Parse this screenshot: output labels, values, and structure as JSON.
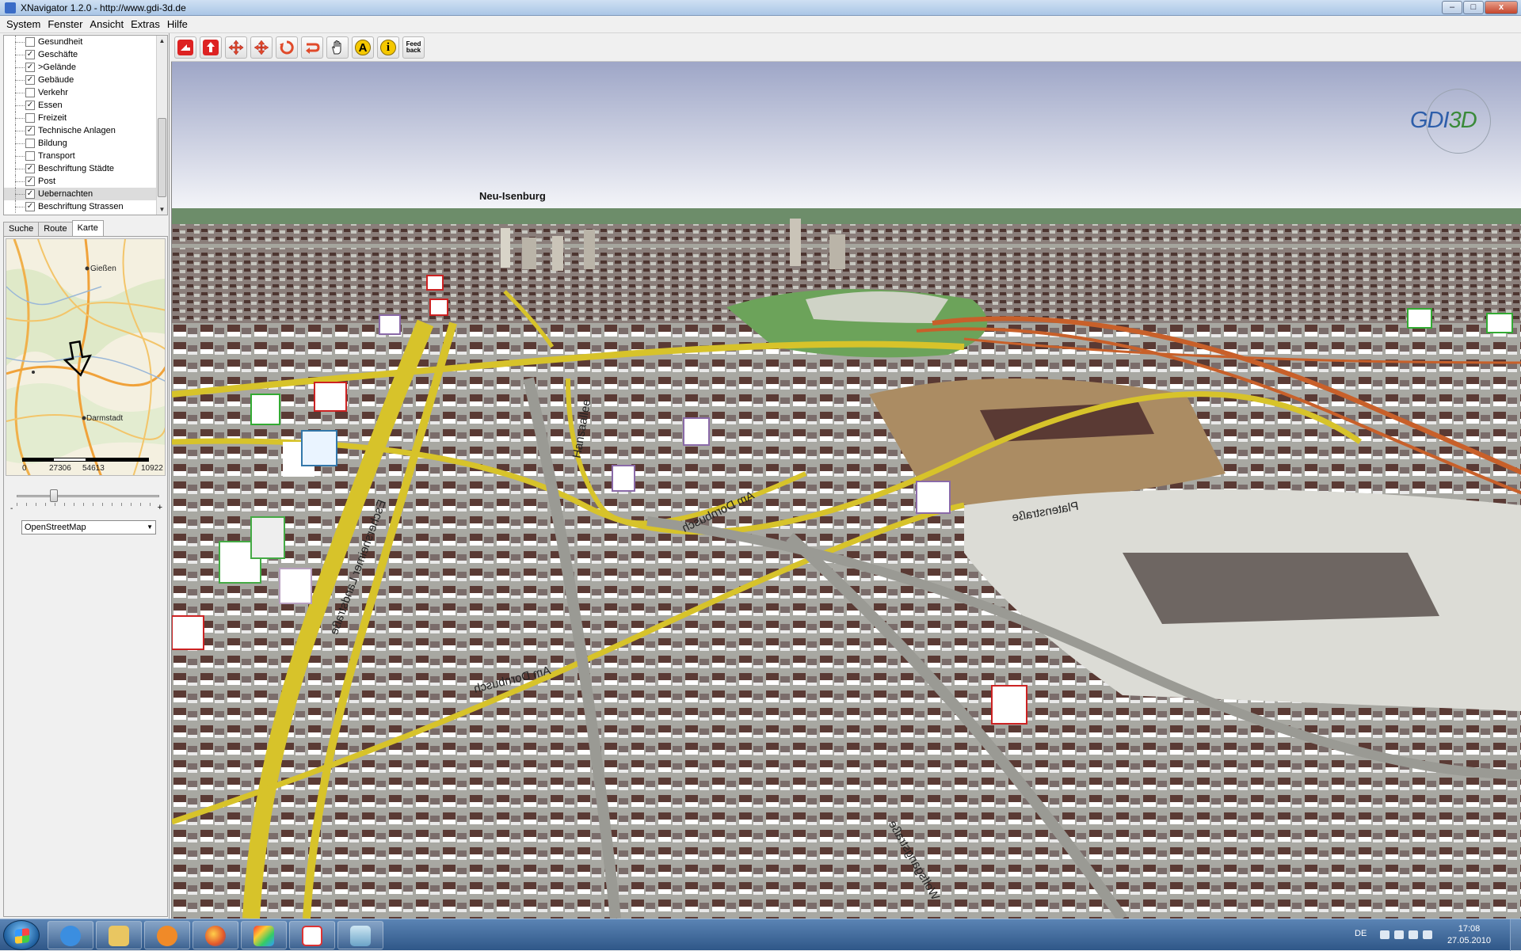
{
  "window": {
    "title": "XNavigator 1.2.0 - http://www.gdi-3d.de",
    "minimize": "–",
    "maximize": "□",
    "close": "x"
  },
  "menu": [
    "System",
    "Fenster",
    "Ansicht",
    "Extras",
    "Hilfe"
  ],
  "layers": [
    {
      "label": "Gesundheit",
      "checked": false
    },
    {
      "label": "Geschäfte",
      "checked": true
    },
    {
      "label": ">Gelände",
      "checked": true
    },
    {
      "label": "Gebäude",
      "checked": true
    },
    {
      "label": "Verkehr",
      "checked": false
    },
    {
      "label": "Essen",
      "checked": true
    },
    {
      "label": "Freizeit",
      "checked": false
    },
    {
      "label": "Technische Anlagen",
      "checked": true
    },
    {
      "label": "Bildung",
      "checked": false
    },
    {
      "label": "Transport",
      "checked": false
    },
    {
      "label": "Beschriftung Städte",
      "checked": true
    },
    {
      "label": "Post",
      "checked": true
    },
    {
      "label": "Uebernachten",
      "checked": true,
      "selected": true
    },
    {
      "label": "Beschriftung Strassen",
      "checked": true
    }
  ],
  "tabs": [
    "Suche",
    "Route",
    "Karte"
  ],
  "active_tab": "Karte",
  "minimap": {
    "cities": [
      "Gießen",
      "Darmstadt"
    ],
    "scale_labels": [
      "0",
      "27306",
      "54613",
      "10922"
    ]
  },
  "zoom_slider": {
    "minus": "-",
    "plus": "+"
  },
  "map_source": {
    "selected": "OpenStreetMap"
  },
  "toolbar": {
    "buttons": [
      {
        "name": "move-forward-button",
        "icon": "red-arrow-forward-icon"
      },
      {
        "name": "move-up-button",
        "icon": "red-arrow-up-icon"
      },
      {
        "name": "pan-button",
        "icon": "red-cross-arrows-icon"
      },
      {
        "name": "move-button",
        "icon": "red-move-arrows-icon"
      },
      {
        "name": "rotate-button",
        "icon": "red-rotate-icon"
      },
      {
        "name": "turn-button",
        "icon": "red-turn-icon"
      },
      {
        "name": "hand-button",
        "icon": "hand-icon"
      },
      {
        "name": "label-button",
        "icon": "letter-a-icon",
        "glyph": "A"
      },
      {
        "name": "info-button",
        "icon": "info-icon",
        "glyph": "i"
      },
      {
        "name": "feedback-button",
        "icon": "feedback-icon",
        "text": "Feed back"
      }
    ]
  },
  "view": {
    "logo": {
      "prefix": "GDI",
      "suffix": "3D"
    },
    "city_label": "Neu-Isenburg",
    "street_labels": [
      "Am Dornbusch",
      "Am Dornbusch",
      "Platenstraße",
      "Hansaallee",
      "Eschersheimer Landstraße",
      "Wolfsgangstraße"
    ],
    "colors": {
      "sky_top": "#9ea6c7",
      "sky_bottom": "#ffffff",
      "ground": "#a3a39a",
      "road": "#d7c32a",
      "park": "#6ca35a",
      "highway": "#c8602a"
    }
  },
  "taskbar": {
    "language": "DE",
    "time": "17:08",
    "date": "27.05.2010",
    "items": [
      "ie-icon",
      "explorer-icon",
      "media-player-icon",
      "firefox-icon",
      "paint-icon",
      "java-icon",
      "xnavigator-icon"
    ]
  }
}
